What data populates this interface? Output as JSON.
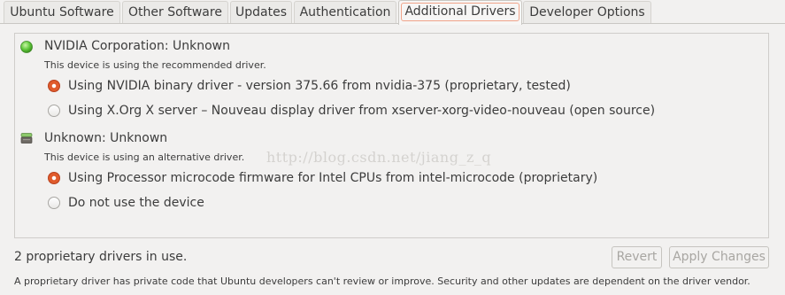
{
  "tabs": [
    {
      "label": "Ubuntu Software",
      "active": false
    },
    {
      "label": "Other Software",
      "active": false
    },
    {
      "label": "Updates",
      "active": false
    },
    {
      "label": "Authentication",
      "active": false
    },
    {
      "label": "Additional Drivers",
      "active": true
    },
    {
      "label": "Developer Options",
      "active": false
    }
  ],
  "devices": [
    {
      "icon": "green-status-light-icon",
      "icon_color": "#5fc73a",
      "title": "NVIDIA Corporation: Unknown",
      "status": "This device is using the recommended driver.",
      "options": [
        {
          "label": "Using NVIDIA binary driver - version 375.66 from nvidia-375 (proprietary, tested)",
          "selected": true
        },
        {
          "label": "Using X.Org X server – Nouveau display driver from xserver-xorg-video-nouveau (open source)",
          "selected": false
        }
      ]
    },
    {
      "icon": "hardware-chip-icon",
      "title": "Unknown: Unknown",
      "status": "This device is using an alternative driver.",
      "options": [
        {
          "label": "Using Processor microcode firmware for Intel CPUs from intel-microcode (proprietary)",
          "selected": true
        },
        {
          "label": "Do not use the device",
          "selected": false
        }
      ]
    }
  ],
  "footer": {
    "status": "2 proprietary drivers in use.",
    "note": "A proprietary driver has private code that Ubuntu developers can't review or improve. Security and other updates are dependent on the driver vendor.",
    "revert_label": "Revert",
    "apply_label": "Apply Changes"
  },
  "watermark": "http://blog.csdn.net/jiang_z_q",
  "colors": {
    "accent": "#e05b2c",
    "background": "#f2f1f0"
  }
}
